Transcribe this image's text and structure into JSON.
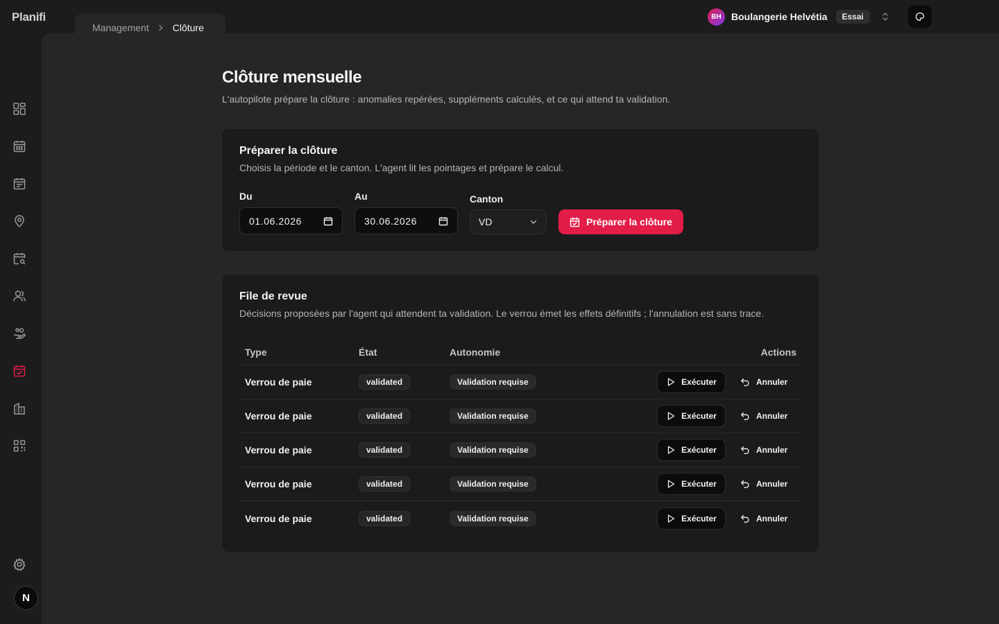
{
  "app": {
    "logo": "Planifi"
  },
  "breadcrumb": {
    "parent": "Management",
    "current": "Clôture"
  },
  "org": {
    "initials": "BH",
    "name": "Boulangerie Helvétia",
    "plan": "Essai"
  },
  "sidebar": {
    "items": [
      {
        "icon": "dashboard-icon",
        "active": false
      },
      {
        "icon": "calendar-icon",
        "active": false
      },
      {
        "icon": "calendar-list-icon",
        "active": false
      },
      {
        "icon": "map-pin-icon",
        "active": false
      },
      {
        "icon": "calendar-search-icon",
        "active": false
      },
      {
        "icon": "users-icon",
        "active": false
      },
      {
        "icon": "hand-coins-icon",
        "active": false
      },
      {
        "icon": "calendar-check-icon",
        "active": true
      },
      {
        "icon": "building-icon",
        "active": false
      },
      {
        "icon": "qr-code-icon",
        "active": false
      }
    ],
    "settings_icon": "gear-icon",
    "user_initial": "N"
  },
  "page": {
    "title": "Clôture mensuelle",
    "subtitle": "L'autopilote prépare la clôture : anomalies repérées, suppléments calculés, et ce qui attend ta validation."
  },
  "prepare": {
    "title": "Préparer la clôture",
    "description": "Choisis la période et le canton. L'agent lit les pointages et prépare le calcul.",
    "from_label": "Du",
    "from_value": "01.06.2026",
    "to_label": "Au",
    "to_value": "30.06.2026",
    "canton_label": "Canton",
    "canton_value": "VD",
    "submit_label": "Préparer la clôture",
    "accent": "#e11d48"
  },
  "queue": {
    "title": "File de revue",
    "description": "Décisions proposées par l'agent qui attendent ta validation. Le verrou émet les effets définitifs ; l'annulation est sans trace.",
    "columns": {
      "type": "Type",
      "state": "État",
      "autonomy": "Autonomie",
      "actions": "Actions"
    },
    "rows": [
      {
        "type": "Verrou de paie",
        "state": "validated",
        "autonomy": "Validation requise",
        "execute": "Exécuter",
        "cancel": "Annuler"
      },
      {
        "type": "Verrou de paie",
        "state": "validated",
        "autonomy": "Validation requise",
        "execute": "Exécuter",
        "cancel": "Annuler"
      },
      {
        "type": "Verrou de paie",
        "state": "validated",
        "autonomy": "Validation requise",
        "execute": "Exécuter",
        "cancel": "Annuler"
      },
      {
        "type": "Verrou de paie",
        "state": "validated",
        "autonomy": "Validation requise",
        "execute": "Exécuter",
        "cancel": "Annuler"
      },
      {
        "type": "Verrou de paie",
        "state": "validated",
        "autonomy": "Validation requise",
        "execute": "Exécuter",
        "cancel": "Annuler"
      }
    ]
  }
}
